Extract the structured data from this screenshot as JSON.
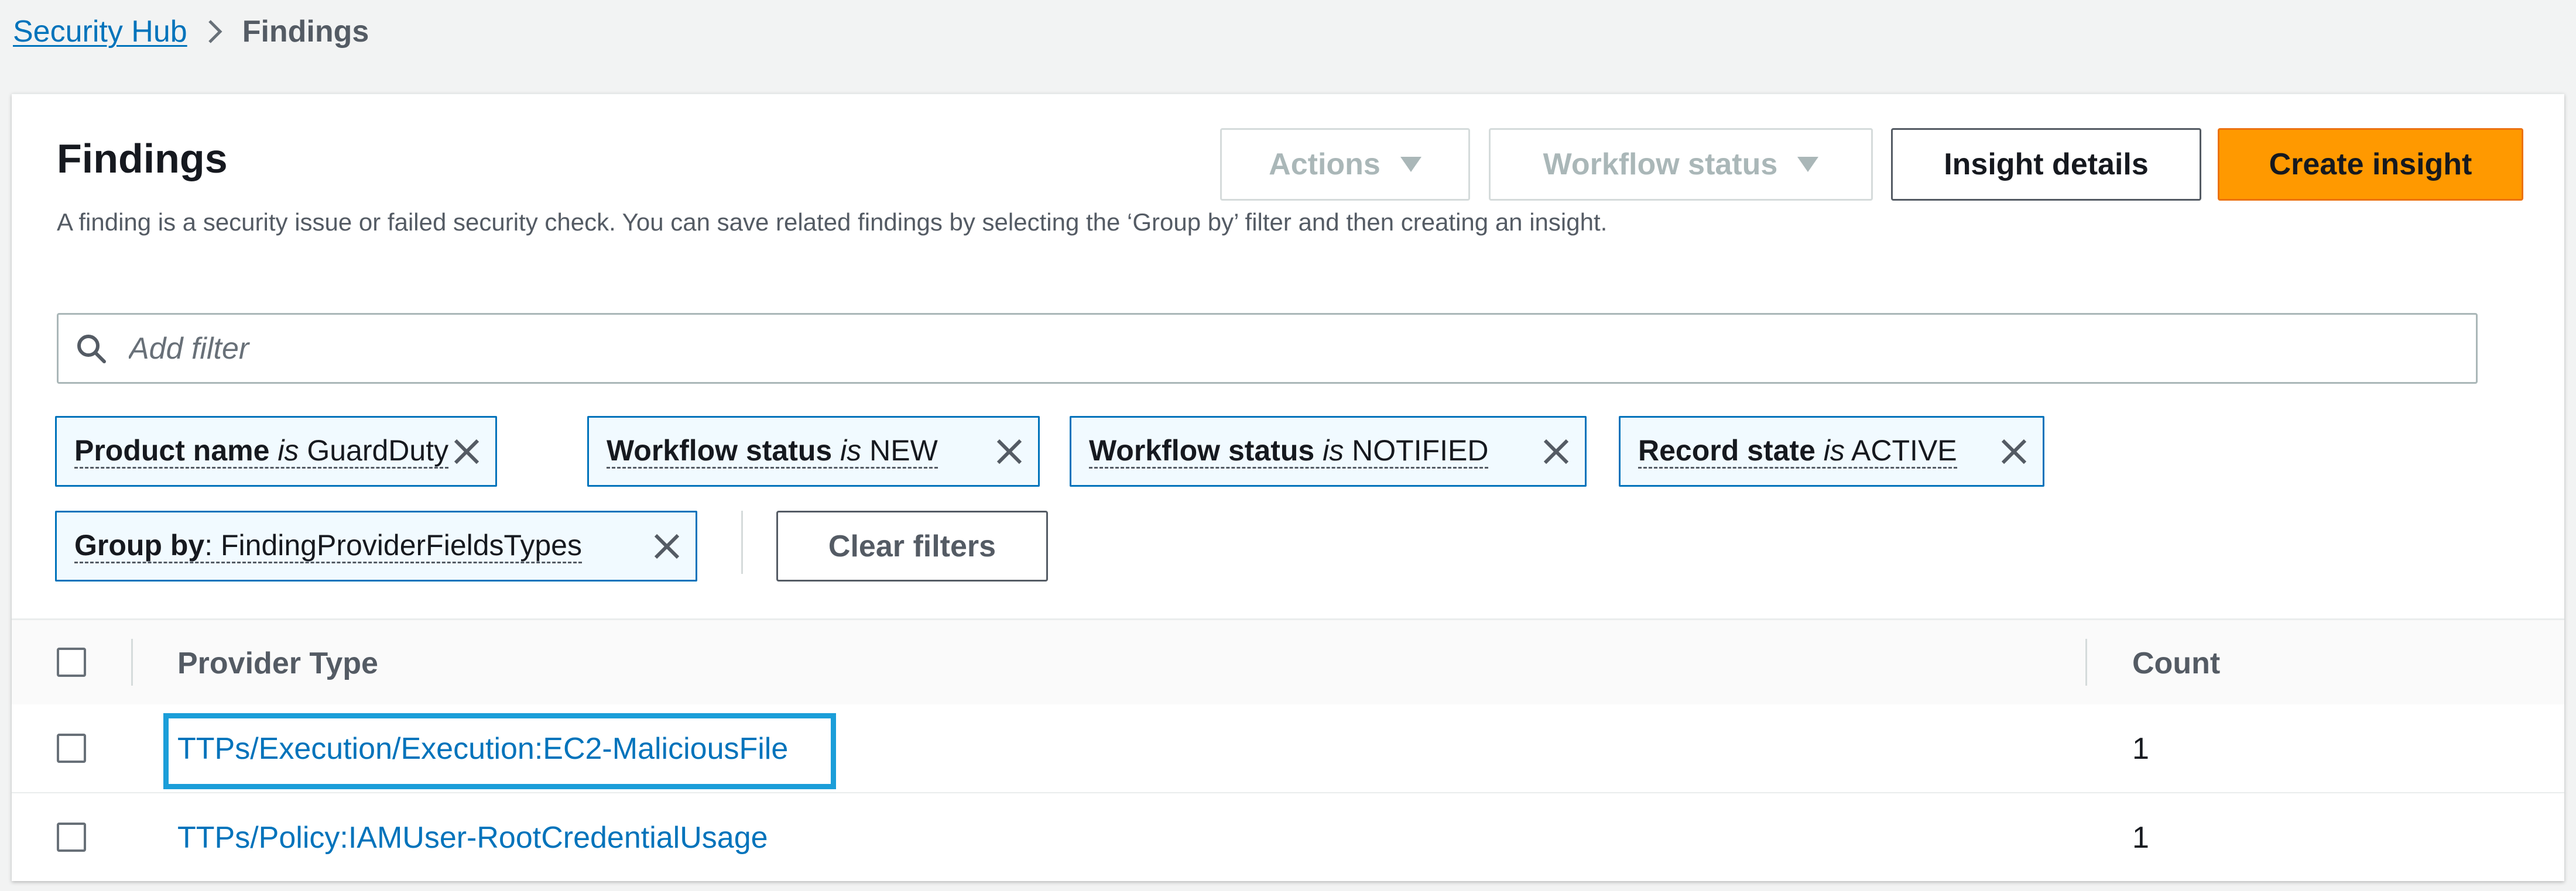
{
  "breadcrumb": {
    "root": "Security Hub",
    "current": "Findings"
  },
  "header": {
    "title": "Findings",
    "description": "A finding is a security issue or failed security check. You can save related findings by selecting the ‘Group by’ filter and then creating an insight.",
    "actions_label": "Actions",
    "workflow_status_label": "Workflow status",
    "insight_details_label": "Insight details",
    "create_insight_label": "Create insight"
  },
  "search": {
    "placeholder": "Add filter",
    "value": ""
  },
  "filters": [
    {
      "key": "Product name",
      "op": "is",
      "value": "GuardDuty"
    },
    {
      "key": "Workflow status",
      "op": "is",
      "value": "NEW"
    },
    {
      "key": "Workflow status",
      "op": "is",
      "value": "NOTIFIED"
    },
    {
      "key": "Record state",
      "op": "is",
      "value": "ACTIVE"
    }
  ],
  "group_by": {
    "key": "Group by",
    "value": ": FindingProviderFieldsTypes"
  },
  "clear_filters_label": "Clear filters",
  "table": {
    "columns": [
      "Provider Type",
      "Count"
    ],
    "rows": [
      {
        "provider_type": "TTPs/Execution/Execution:EC2-MaliciousFile",
        "count": "1",
        "highlighted": true
      },
      {
        "provider_type": "TTPs/Policy:IAMUser-RootCredentialUsage",
        "count": "1",
        "highlighted": false
      }
    ]
  },
  "colors": {
    "link": "#0073bb",
    "primary": "#ff9900",
    "highlight": "#1b9ed9",
    "token_bg": "#f1faff"
  }
}
